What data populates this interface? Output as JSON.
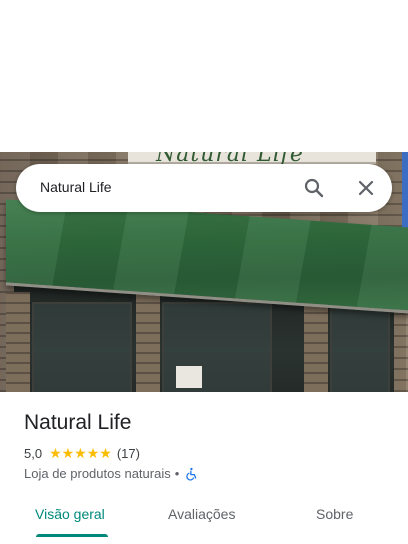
{
  "search": {
    "query": "Natural Life"
  },
  "photo": {
    "sign_text": "Natural Life"
  },
  "place": {
    "name": "Natural Life",
    "rating": "5,0",
    "stars": "★★★★★",
    "review_count": "(17)",
    "category": "Loja de produtos naturais",
    "separator": "•",
    "accessibility_icon": "wheelchair-icon"
  },
  "tabs": [
    {
      "label": "Visão geral",
      "active": true
    },
    {
      "label": "Avaliações",
      "active": false
    },
    {
      "label": "Sobre",
      "active": false
    }
  ],
  "colors": {
    "accent": "#00897b",
    "star": "#fbbc04",
    "accessibility": "#1a73e8"
  }
}
